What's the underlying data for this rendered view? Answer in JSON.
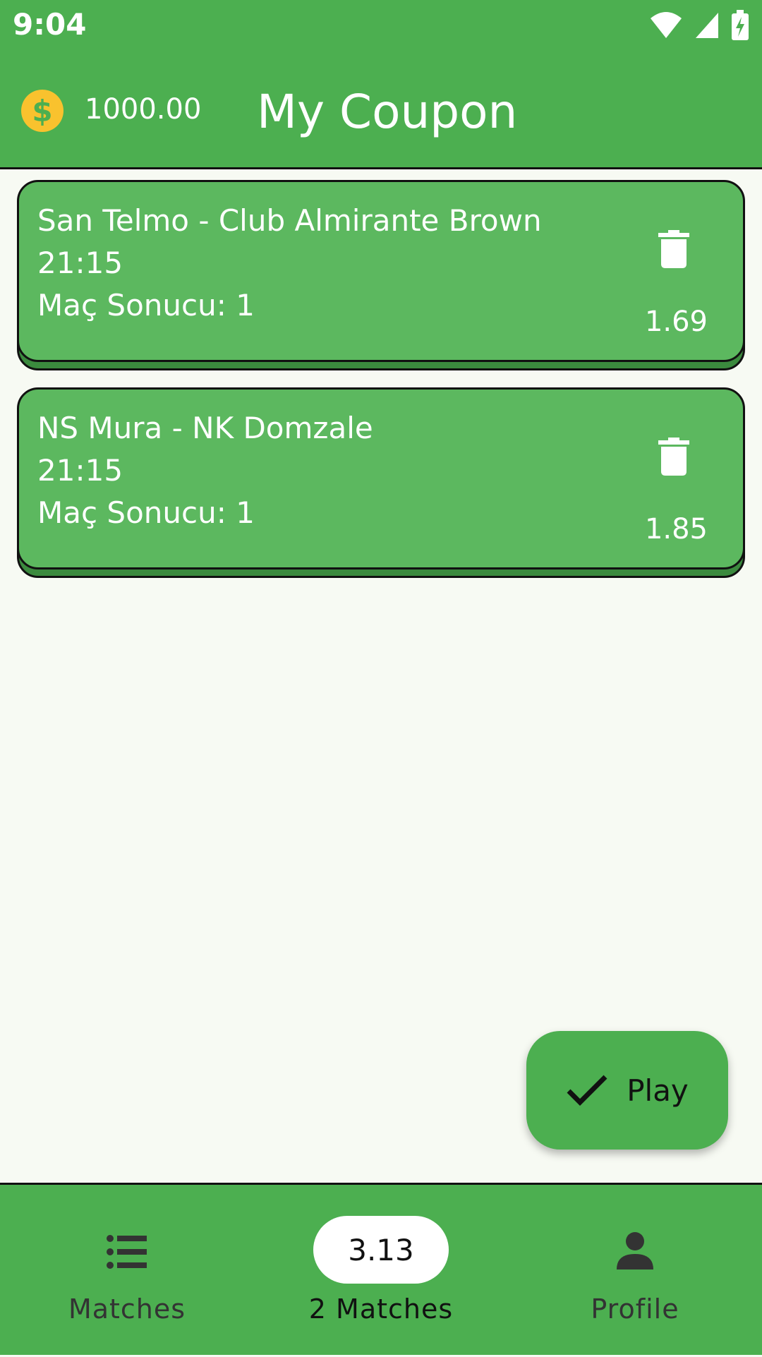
{
  "status_bar": {
    "time": "9:04"
  },
  "header": {
    "balance": "1000.00",
    "coin_symbol": "$",
    "title": "My Coupon"
  },
  "coupon": {
    "items": [
      {
        "match": "San Telmo - Club Almirante Brown",
        "time": "21:15",
        "market": "Maç Sonucu: 1",
        "odds": "1.69"
      },
      {
        "match": "NS Mura - NK Domzale",
        "time": "21:15",
        "market": "Maç Sonucu: 1",
        "odds": "1.85"
      }
    ]
  },
  "fab": {
    "label": "Play"
  },
  "bottom_nav": {
    "matches_label": "Matches",
    "total_odds": "3.13",
    "selected_count_label": "2 Matches",
    "profile_label": "Profile"
  },
  "colors": {
    "primary": "#4CAF50",
    "card": "#5CB85F",
    "card_shadow": "#3B8A3E",
    "coin": "#F9C22E",
    "background": "#F7FAF3"
  },
  "icons": [
    "wifi-icon",
    "signal-icon",
    "battery-icon",
    "coin-icon",
    "trash-icon",
    "check-icon",
    "list-icon",
    "person-icon"
  ]
}
